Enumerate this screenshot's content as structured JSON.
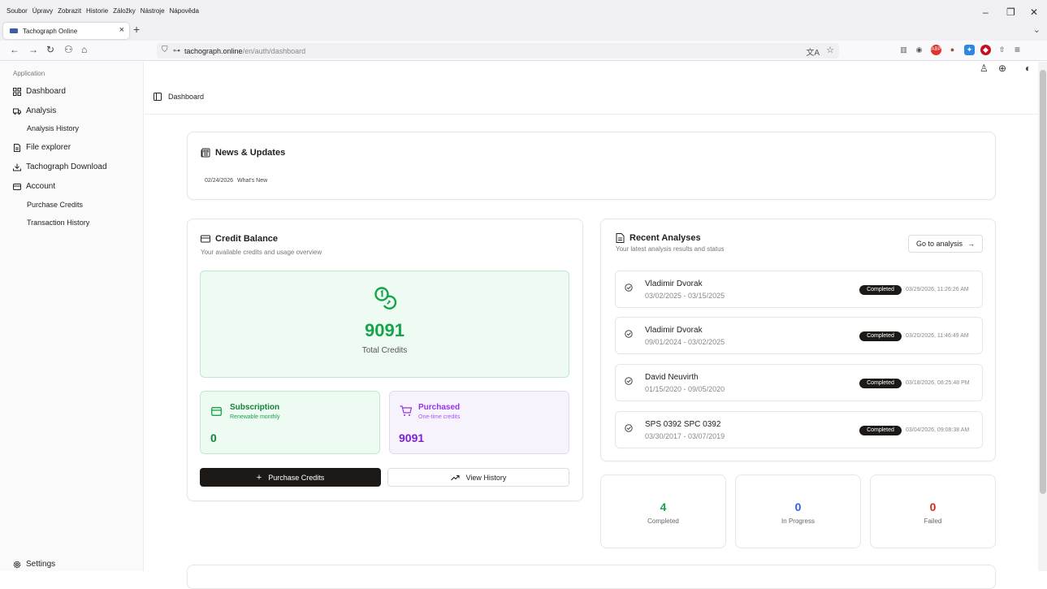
{
  "browser": {
    "menu": [
      "Soubor",
      "Úpravy",
      "Zobrazit",
      "Historie",
      "Záložky",
      "Nástroje",
      "Nápověda"
    ],
    "tab_title": "Tachograph Online",
    "url_host": "tachograph.online",
    "url_path": "/en/auth/dashboard"
  },
  "sidebar": {
    "group_label": "Application",
    "items": {
      "dashboard": "Dashboard",
      "analysis": "Analysis",
      "analysis_history": "Analysis History",
      "file_explorer": "File explorer",
      "tachograph_download": "Tachograph Download",
      "account": "Account",
      "purchase_credits": "Purchase Credits",
      "transaction_history": "Transaction History",
      "settings": "Settings"
    }
  },
  "header": {
    "breadcrumb": "Dashboard"
  },
  "news": {
    "title": "News & Updates",
    "items": [
      {
        "date": "02/24/2026",
        "text": "What's New"
      }
    ]
  },
  "credits": {
    "title": "Credit Balance",
    "subtitle": "Your available credits and usage overview",
    "total_value": "9091",
    "total_label": "Total Credits",
    "subscription": {
      "title": "Subscription",
      "subtitle": "Renewable monthly",
      "value": "0"
    },
    "purchased": {
      "title": "Purchased",
      "subtitle": "One-time credits",
      "value": "9091"
    },
    "purchase_button": "Purchase Credits",
    "history_button": "View History"
  },
  "recent": {
    "title": "Recent Analyses",
    "subtitle": "Your latest analysis results and status",
    "go_button": "Go to analysis",
    "items": [
      {
        "name": "Vladimir Dvorak",
        "range": "03/02/2025 - 03/15/2025",
        "status": "Completed",
        "timestamp": "03/29/2026, 11:26:26 AM"
      },
      {
        "name": "Vladimir Dvorak",
        "range": "09/01/2024 - 03/02/2025",
        "status": "Completed",
        "timestamp": "03/20/2026, 11:46:49 AM"
      },
      {
        "name": "David Neuvirth",
        "range": "01/15/2020 - 09/05/2020",
        "status": "Completed",
        "timestamp": "03/18/2026, 08:25:48 PM"
      },
      {
        "name": "SPS 0392 SPC 0392",
        "range": "03/30/2017 - 03/07/2019",
        "status": "Completed",
        "timestamp": "03/04/2026, 09:08:38 AM"
      }
    ]
  },
  "stats": {
    "completed": {
      "value": "4",
      "label": "Completed"
    },
    "in_progress": {
      "value": "0",
      "label": "In Progress"
    },
    "failed": {
      "value": "0",
      "label": "Failed"
    }
  },
  "colors": {
    "green": "#16a34a",
    "blue": "#2563eb",
    "red": "#dc2626",
    "purple": "#9333ea",
    "dark": "#1c1917"
  }
}
